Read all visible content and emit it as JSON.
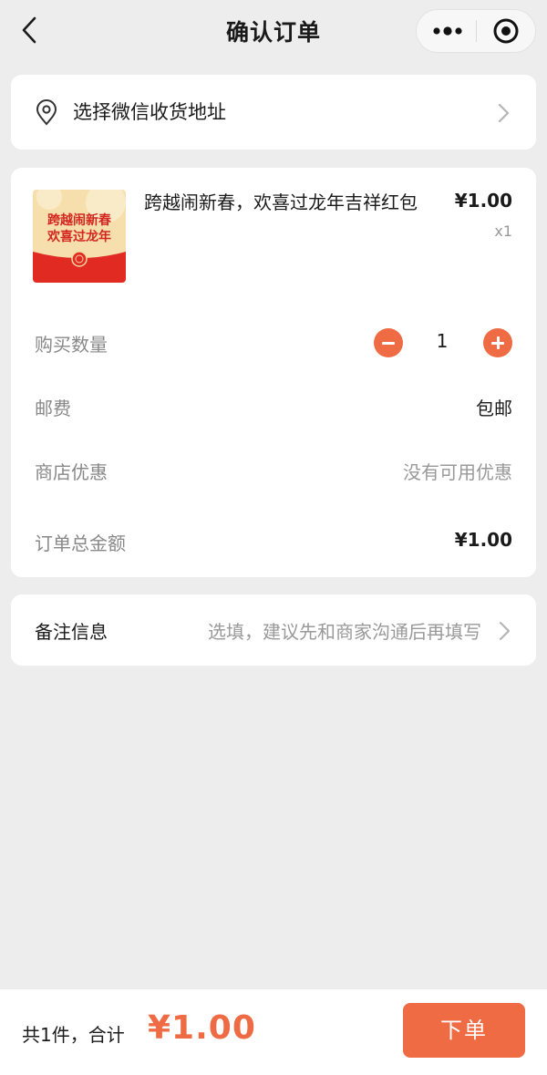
{
  "nav": {
    "title": "确认订单"
  },
  "address": {
    "label": "选择微信收货地址"
  },
  "product": {
    "name": "跨越闹新春，欢喜过龙年吉祥红包",
    "price": "¥1.00",
    "qty": "x1",
    "thumb_line1": "跨越闹新春",
    "thumb_line2": "欢喜过龙年"
  },
  "rows": {
    "quantity_label": "购买数量",
    "quantity_value": "1",
    "shipping_label": "邮费",
    "shipping_value": "包邮",
    "discount_label": "商店优惠",
    "discount_value": "没有可用优惠",
    "total_label": "订单总金额",
    "total_value": "¥1.00"
  },
  "remark": {
    "label": "备注信息",
    "hint": "选填，建议先和商家沟通后再填写"
  },
  "footer": {
    "count_text": "共1件，合计",
    "total": "¥1.00",
    "submit_label": "下单"
  },
  "colors": {
    "accent": "#ee6b44",
    "background": "#ededed",
    "card": "#ffffff"
  },
  "icons": [
    "back-arrow-icon",
    "more-dots-icon",
    "target-close-icon",
    "location-pin-icon",
    "chevron-right-icon",
    "minus-icon",
    "plus-icon"
  ]
}
